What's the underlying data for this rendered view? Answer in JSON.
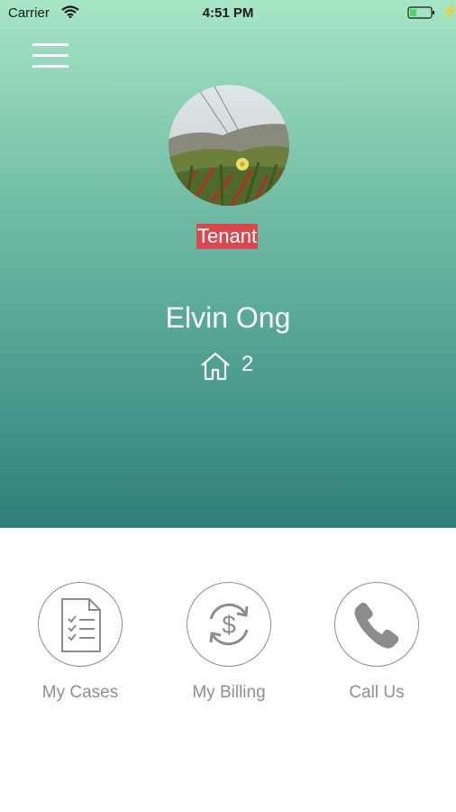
{
  "status_bar": {
    "carrier": "Carrier",
    "time": "4:51 PM",
    "battery_level": 0.2
  },
  "profile": {
    "role_badge": "Tenant",
    "name": "Elvin Ong",
    "home_count": "2"
  },
  "actions": [
    {
      "label": "My Cases",
      "icon": "document-checklist-icon"
    },
    {
      "label": "My Billing",
      "icon": "dollar-cycle-icon"
    },
    {
      "label": "Call Us",
      "icon": "phone-icon"
    }
  ],
  "colors": {
    "header_gradient_top": "#a6e6c4",
    "header_gradient_bottom": "#2f7f7a",
    "badge": "#d9484f",
    "icon_gray": "#8c8c8c",
    "battery_green": "#4cd964"
  }
}
